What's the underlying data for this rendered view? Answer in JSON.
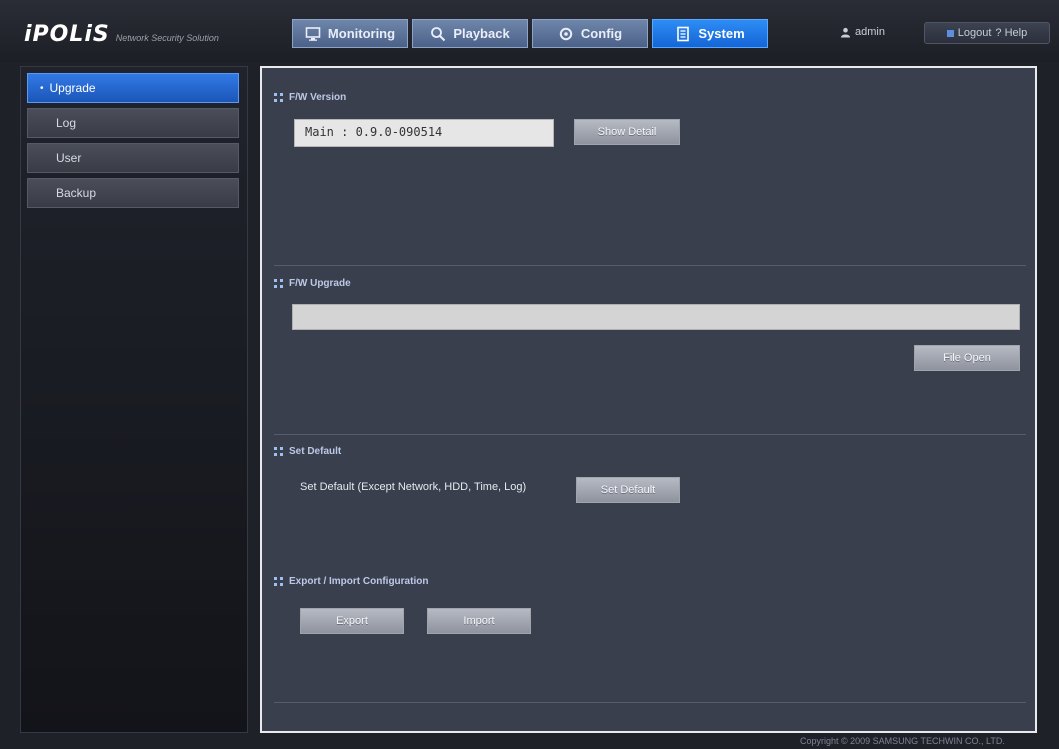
{
  "header": {
    "logo_main": "iPOLiS",
    "logo_sub": "Network Security Solution",
    "nav": [
      {
        "label": "Monitoring",
        "icon": "monitor-icon",
        "active": false
      },
      {
        "label": "Playback",
        "icon": "search-icon",
        "active": false
      },
      {
        "label": "Config",
        "icon": "gear-icon",
        "active": false
      },
      {
        "label": "System",
        "icon": "document-icon",
        "active": true
      }
    ],
    "user": "admin",
    "logout_label": "Logout",
    "help_label": "? Help"
  },
  "sidebar": {
    "items": [
      {
        "label": "Upgrade",
        "active": true
      },
      {
        "label": "Log",
        "active": false
      },
      {
        "label": "User",
        "active": false
      },
      {
        "label": "Backup",
        "active": false
      }
    ]
  },
  "main": {
    "fw_version": {
      "title": "F/W Version",
      "value": "Main : 0.9.0-090514",
      "show_detail_label": "Show Detail"
    },
    "fw_upgrade": {
      "title": "F/W Upgrade",
      "file_path": "",
      "file_open_label": "File Open"
    },
    "set_default": {
      "title": "Set Default",
      "description": "Set Default (Except Network, HDD, Time, Log)",
      "button_label": "Set Default"
    },
    "export_import": {
      "title": "Export / Import Configuration",
      "export_label": "Export",
      "import_label": "Import"
    }
  },
  "footer": {
    "copyright": "Copyright © 2009 SAMSUNG TECHWIN CO., LTD."
  },
  "colors": {
    "accent_active": "#1b6ce0",
    "nav_inactive": "#5a709a",
    "panel_bg": "#3a3f4e"
  }
}
